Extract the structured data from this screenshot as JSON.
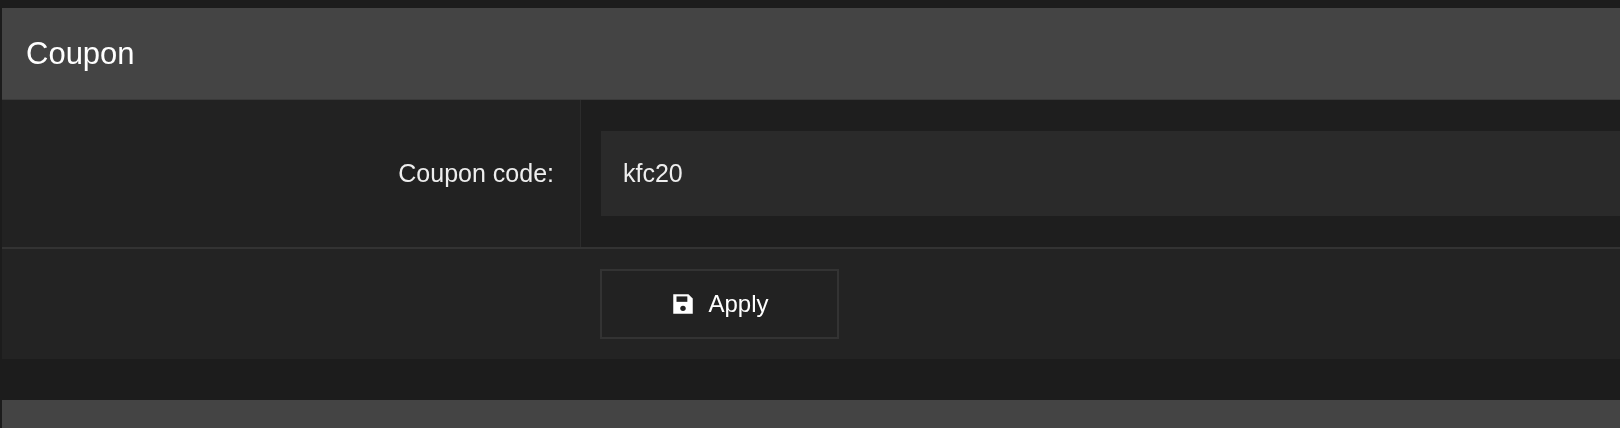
{
  "panel": {
    "title": "Coupon"
  },
  "form": {
    "label": "Coupon code:",
    "value": "kfc20"
  },
  "apply_button": {
    "label": "Apply"
  }
}
